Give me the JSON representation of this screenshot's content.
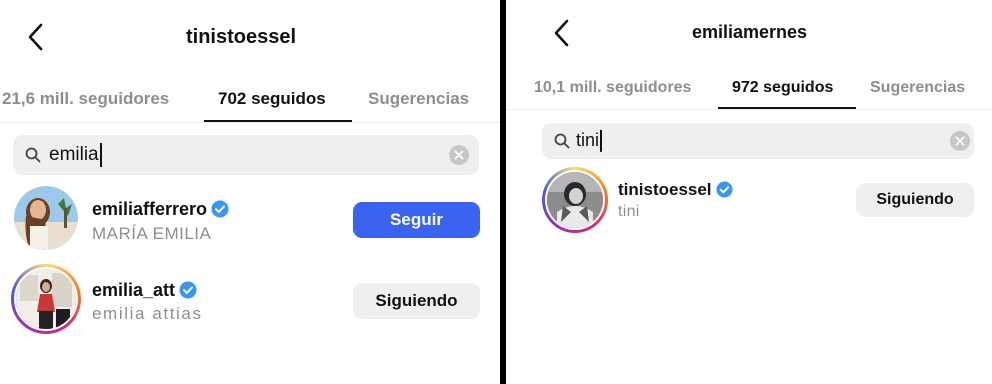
{
  "left": {
    "title": "tinistoessel",
    "tabs": [
      {
        "label": "21,6 mill. seguidores",
        "active": false
      },
      {
        "label": "702 seguidos",
        "active": true
      },
      {
        "label": "Sugerencias",
        "active": false
      }
    ],
    "search": {
      "value": "emilia"
    },
    "results": [
      {
        "username": "emiliafferrero",
        "verified": true,
        "full_name": "MARÍA EMILIA",
        "button": "Seguir",
        "button_style": "primary"
      },
      {
        "username": "emilia_att",
        "verified": true,
        "full_name": "emilia attias",
        "button": "Siguiendo",
        "button_style": "secondary"
      }
    ]
  },
  "right": {
    "title": "emiliamernes",
    "tabs": [
      {
        "label": "10,1 mill. seguidores",
        "active": false
      },
      {
        "label": "972 seguidos",
        "active": true
      },
      {
        "label": "Sugerencias",
        "active": false
      }
    ],
    "search": {
      "value": "tini"
    },
    "results": [
      {
        "username": "tinistoessel",
        "verified": true,
        "full_name": "tini",
        "button": "Siguiendo",
        "button_style": "secondary"
      }
    ]
  },
  "icons": {
    "back": "chevron-left-icon",
    "search": "search-icon",
    "clear": "clear-icon",
    "verified": "verified-badge-icon"
  },
  "colors": {
    "primary_button": "#3a64f0",
    "verified": "#3897f0",
    "secondary_text": "#8e8e8e",
    "search_bg": "#efefef"
  }
}
